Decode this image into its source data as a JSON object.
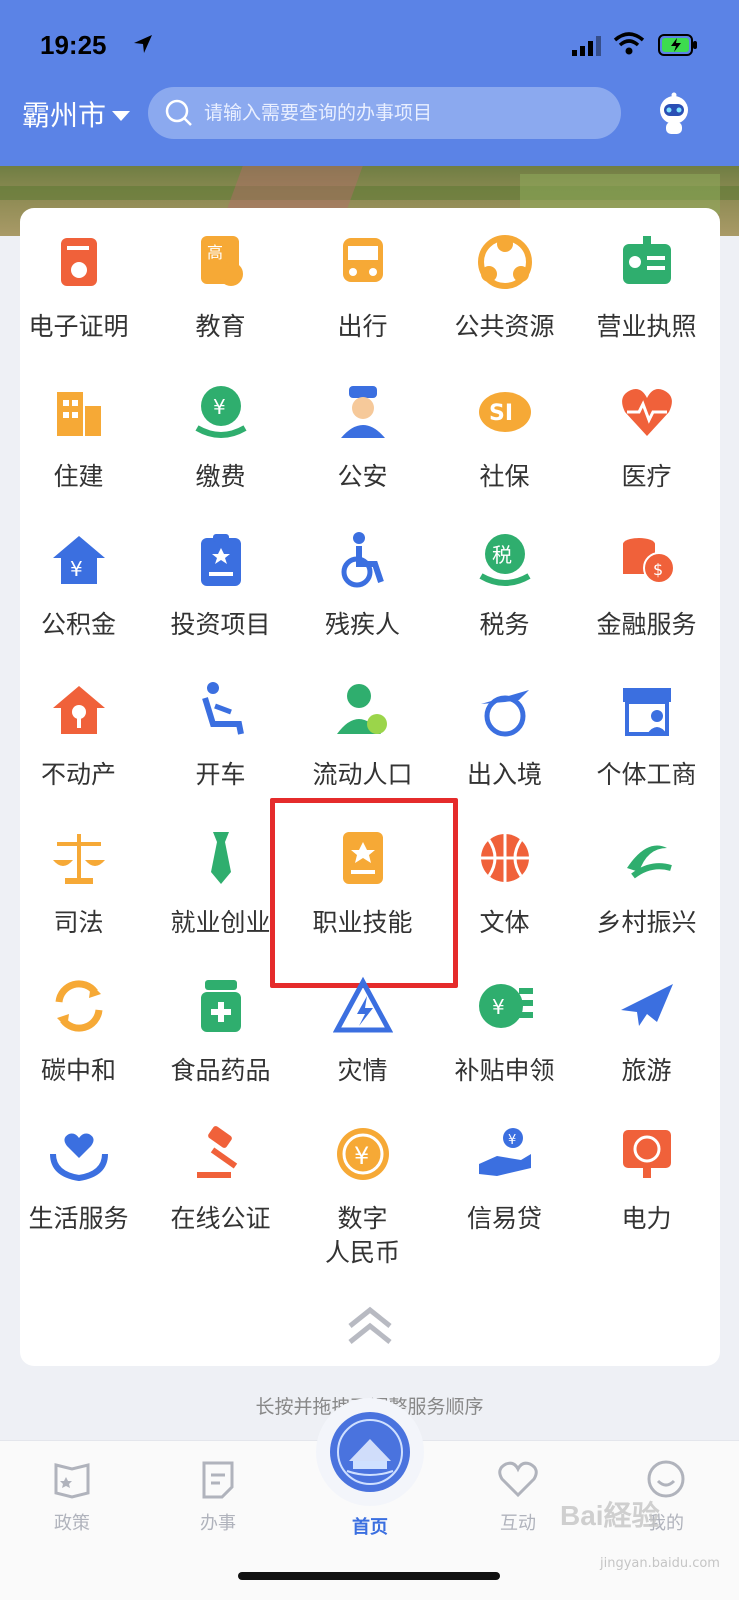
{
  "status_bar": {
    "time": "19:25"
  },
  "header": {
    "city": "霸州市",
    "search_placeholder": "请输入需要查询的办事项目"
  },
  "services": [
    {
      "label": "电子证明",
      "icon": "certificate-icon",
      "color": "#f0613a"
    },
    {
      "label": "教育",
      "icon": "education-icon",
      "color": "#f6a936"
    },
    {
      "label": "出行",
      "icon": "bus-icon",
      "color": "#f6a936"
    },
    {
      "label": "公共资源",
      "icon": "share-resource-icon",
      "color": "#f6a936"
    },
    {
      "label": "营业执照",
      "icon": "business-license-icon",
      "color": "#2fae6e"
    },
    {
      "label": "住建",
      "icon": "building-icon",
      "color": "#f6a936"
    },
    {
      "label": "缴费",
      "icon": "payment-icon",
      "color": "#2fae6e"
    },
    {
      "label": "公安",
      "icon": "police-icon",
      "color": "#3b6fe0"
    },
    {
      "label": "社保",
      "icon": "social-security-icon",
      "color": "#f6a936"
    },
    {
      "label": "医疗",
      "icon": "heart-pulse-icon",
      "color": "#f0613a"
    },
    {
      "label": "公积金",
      "icon": "housing-fund-icon",
      "color": "#3b6fe0"
    },
    {
      "label": "投资项目",
      "icon": "investment-icon",
      "color": "#3b6fe0"
    },
    {
      "label": "残疾人",
      "icon": "wheelchair-icon",
      "color": "#3b6fe0"
    },
    {
      "label": "税务",
      "icon": "tax-icon",
      "color": "#2fae6e"
    },
    {
      "label": "金融服务",
      "icon": "coins-icon",
      "color": "#f0613a"
    },
    {
      "label": "不动产",
      "icon": "real-estate-icon",
      "color": "#f0613a"
    },
    {
      "label": "开车",
      "icon": "driver-icon",
      "color": "#3b6fe0"
    },
    {
      "label": "流动人口",
      "icon": "migrant-icon",
      "color": "#2fae6e"
    },
    {
      "label": "出入境",
      "icon": "airplane-globe-icon",
      "color": "#3b6fe0"
    },
    {
      "label": "个体工商",
      "icon": "shop-icon",
      "color": "#3b6fe0"
    },
    {
      "label": "司法",
      "icon": "scales-icon",
      "color": "#f6a936"
    },
    {
      "label": "就业创业",
      "icon": "tie-icon",
      "color": "#2fae6e"
    },
    {
      "label": "职业技能",
      "icon": "skill-badge-icon",
      "color": "#f6a936"
    },
    {
      "label": "文体",
      "icon": "basketball-icon",
      "color": "#f0613a"
    },
    {
      "label": "乡村振兴",
      "icon": "rural-icon",
      "color": "#2fae6e"
    },
    {
      "label": "碳中和",
      "icon": "recycle-icon",
      "color": "#f6a936"
    },
    {
      "label": "食品药品",
      "icon": "medicine-icon",
      "color": "#2fae6e"
    },
    {
      "label": "灾情",
      "icon": "disaster-icon",
      "color": "#3b6fe0"
    },
    {
      "label": "补贴申领",
      "icon": "subsidy-icon",
      "color": "#2fae6e"
    },
    {
      "label": "旅游",
      "icon": "plane-icon",
      "color": "#3b6fe0"
    },
    {
      "label": "生活服务",
      "icon": "care-icon",
      "color": "#3b6fe0"
    },
    {
      "label": "在线公证",
      "icon": "gavel-icon",
      "color": "#f0613a"
    },
    {
      "label": "数字\n人民币",
      "icon": "yuan-coin-icon",
      "color": "#f6a936"
    },
    {
      "label": "信易贷",
      "icon": "loan-icon",
      "color": "#3b6fe0"
    },
    {
      "label": "电力",
      "icon": "power-icon",
      "color": "#f0613a"
    }
  ],
  "hint": "长按并拖拽可调整服务顺序",
  "tabs": [
    {
      "label": "政策",
      "icon": "policy-icon"
    },
    {
      "label": "办事",
      "icon": "affairs-icon"
    },
    {
      "label": "首页",
      "icon": "home-emblem-icon"
    },
    {
      "label": "互动",
      "icon": "heart-icon"
    },
    {
      "label": "我的",
      "icon": "profile-icon"
    }
  ],
  "watermark": {
    "brand": "Bai経验",
    "url": "jingyan.baidu.com"
  }
}
